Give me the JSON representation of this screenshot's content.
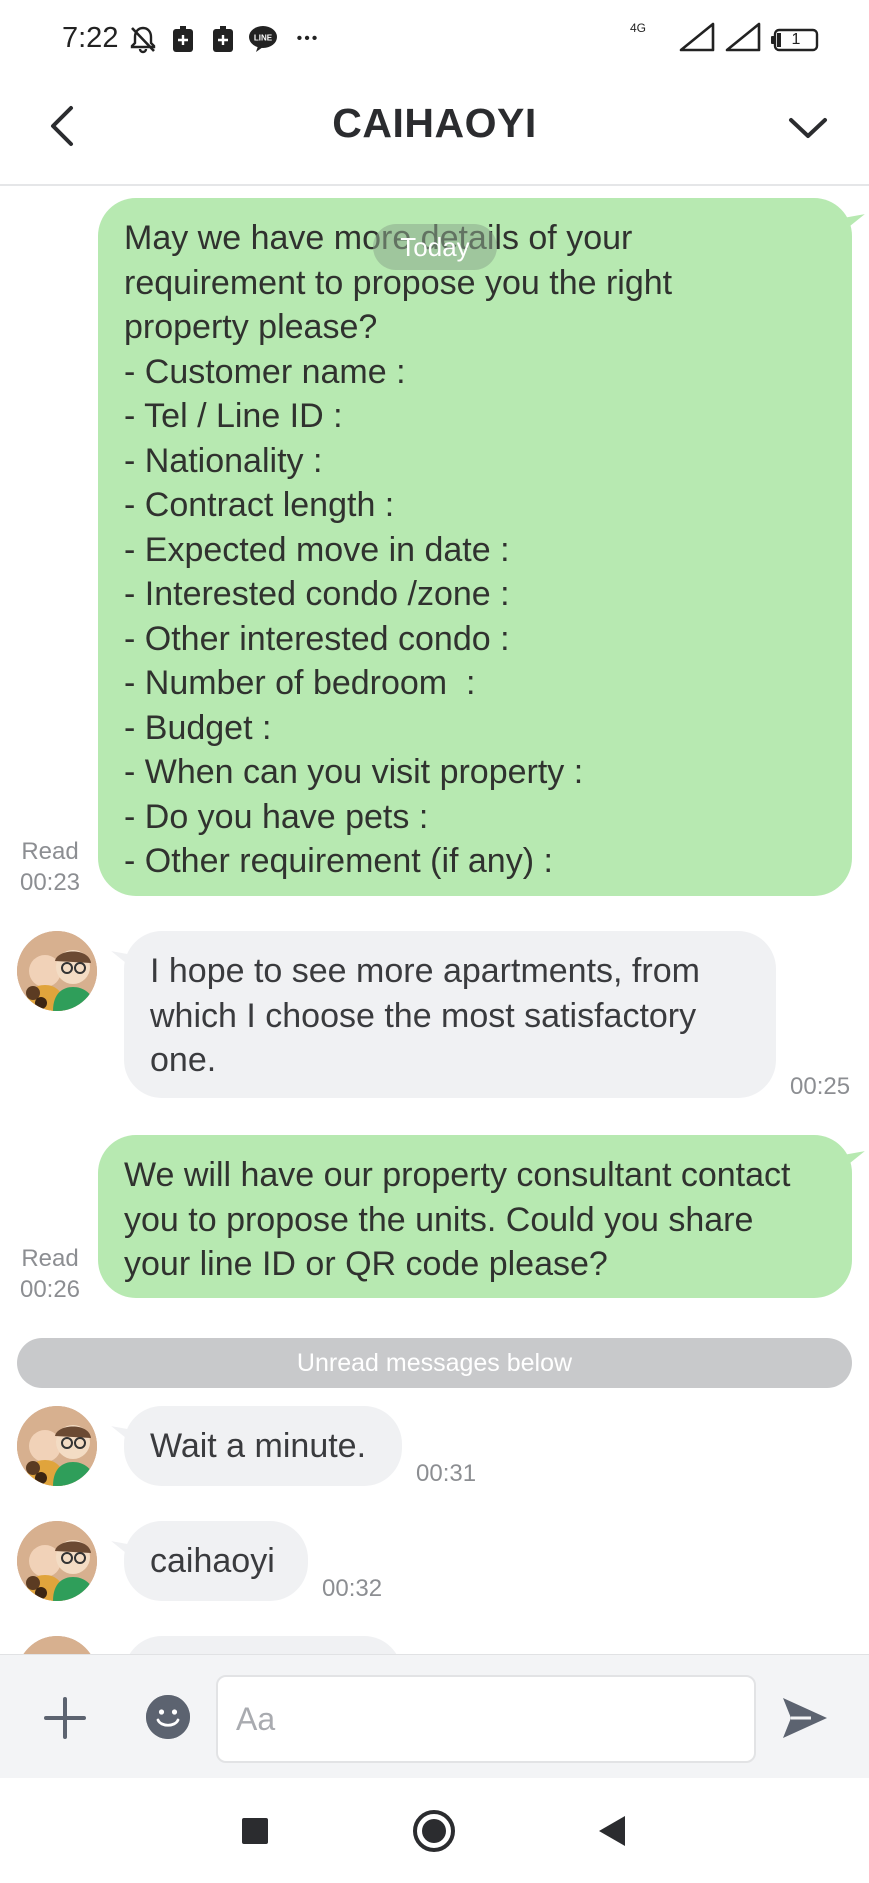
{
  "status_bar": {
    "time": "7:22",
    "network_label": "4G",
    "battery_level": "1",
    "more_glyph": "•••",
    "icons": [
      "mute-icon",
      "sim-icon",
      "sim-icon",
      "line-app-icon",
      "more-icon",
      "signal-icon",
      "signal-icon",
      "battery-icon"
    ]
  },
  "header": {
    "title": "CAIHAOYI"
  },
  "chat": {
    "date_divider": "Today",
    "messages": [
      {
        "direction": "out",
        "lines": [
          "May we have more details of your",
          "requirement to propose you the right",
          "property please?",
          "- Customer name :",
          "- Tel / Line ID :",
          "- Nationality :",
          "- Contract length :",
          "- Expected move in date :",
          "- Interested condo /zone :",
          "- Other interested condo :",
          "- Number of bedroom  :",
          "- Budget :",
          "- When can you visit property :",
          "- Do you have pets :",
          "- Other requirement (if any) :"
        ],
        "read_label": "Read",
        "time": "00:23"
      },
      {
        "direction": "in",
        "lines": [
          "I hope to see more apartments, from",
          "which I choose the most satisfactory",
          "one."
        ],
        "time": "00:25"
      },
      {
        "direction": "out",
        "lines": [
          "We will have our property consultant contact",
          "you to propose the units. Could you share",
          "your line ID or QR code please?"
        ],
        "read_label": "Read",
        "time": "00:26"
      },
      {
        "direction": "in",
        "lines": [
          "Wait a minute."
        ],
        "time": "00:31"
      },
      {
        "direction": "in",
        "lines": [
          "caihaoyi"
        ],
        "time": "00:32"
      }
    ],
    "unread_divider": "Unread messages below"
  },
  "input_bar": {
    "placeholder": "Aa"
  },
  "colors": {
    "outgoing_bubble": "#b7e9b1",
    "incoming_bubble": "#f0f1f3",
    "divider_pill": "#c8c9cb",
    "icon_dark": "#5c6370"
  }
}
